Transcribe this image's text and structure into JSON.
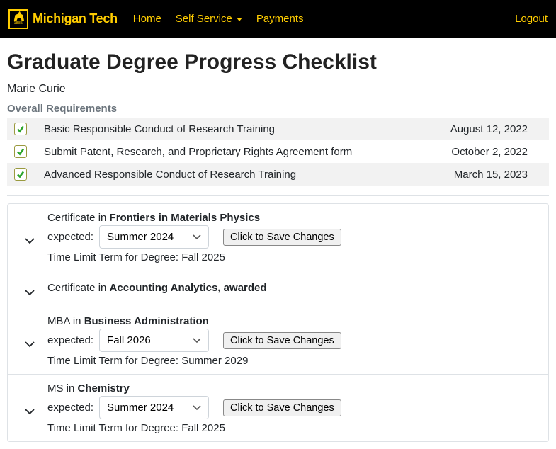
{
  "brand": {
    "name": "Michigan Tech",
    "year": "1885"
  },
  "nav": {
    "home": "Home",
    "self_service": "Self Service",
    "payments": "Payments",
    "logout": "Logout"
  },
  "page": {
    "title": "Graduate Degree Progress Checklist",
    "student": "Marie Curie"
  },
  "overall": {
    "heading": "Overall Requirements",
    "items": [
      {
        "label": "Basic Responsible Conduct of Research Training",
        "date": "August 12, 2022"
      },
      {
        "label": "Submit Patent, Research, and Proprietary Rights Agreement form",
        "date": "October 2, 2022"
      },
      {
        "label": "Advanced Responsible Conduct of Research Training",
        "date": "March 15, 2023"
      }
    ]
  },
  "degrees": [
    {
      "prefix": "Certificate in ",
      "name": "Frontiers in Materials Physics",
      "expected_label": "expected:",
      "expected_value": "Summer 2024",
      "save_label": "Click to Save Changes",
      "timelimit": "Time Limit Term for Degree: Fall 2025"
    },
    {
      "prefix": "Certificate in  ",
      "name": "Accounting Analytics, awarded",
      "awarded": true
    },
    {
      "prefix": "MBA in ",
      "name": "Business Administration",
      "expected_label": "expected:",
      "expected_value": "Fall 2026",
      "save_label": "Click to Save Changes",
      "timelimit": "Time Limit Term for Degree: Summer 2029"
    },
    {
      "prefix": "MS in ",
      "name": "Chemistry",
      "expected_label": "expected:",
      "expected_value": "Summer 2024",
      "save_label": "Click to Save Changes",
      "timelimit": "Time Limit Term for Degree: Fall 2025"
    }
  ]
}
